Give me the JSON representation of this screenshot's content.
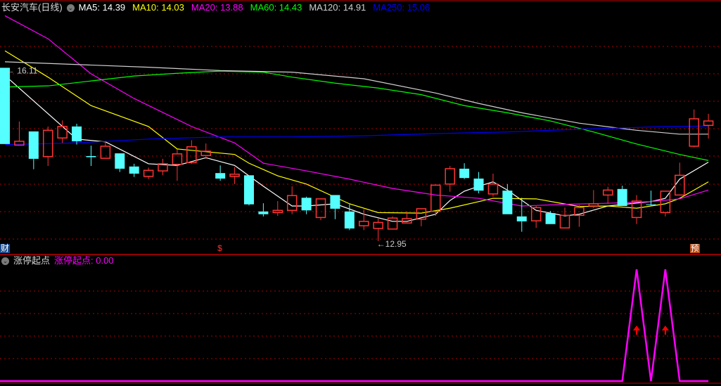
{
  "header": {
    "title": "长安汽车(日线)",
    "ma": [
      {
        "label": "MA5: 14.39",
        "color": "#ffffff"
      },
      {
        "label": "MA10: 14.03",
        "color": "#ffff00"
      },
      {
        "label": "MA20: 13.88",
        "color": "#ff00ff"
      },
      {
        "label": "MA60: 14.43",
        "color": "#00ff00"
      },
      {
        "label": "MA120: 14.91",
        "color": "#d0d0d0"
      },
      {
        "label": "MA250: 15.06",
        "color": "#0000ff"
      }
    ]
  },
  "indicator_header": {
    "name": "涨停起点",
    "value_label": "涨停起点: 0.00",
    "color": "#ff00ff"
  },
  "markers": {
    "cai": "财",
    "dollar": "$",
    "yu": "预"
  },
  "colors": {
    "up": "#ff3333",
    "down": "#55ffff",
    "grid": "#b00000",
    "border": "#c00000"
  },
  "chart_data": {
    "type": "candlestick",
    "price_labels": {
      "high": "16.11",
      "low": "12.95",
      "high_index": 0,
      "low_index": 26
    },
    "ylim": [
      12.55,
      17.15
    ],
    "candles": [
      {
        "o": 16.11,
        "h": 16.11,
        "l": 14.72,
        "c": 14.72
      },
      {
        "o": 14.7,
        "h": 15.13,
        "l": 14.7,
        "c": 14.77
      },
      {
        "o": 14.95,
        "h": 14.95,
        "l": 14.26,
        "c": 14.45
      },
      {
        "o": 14.49,
        "h": 15.04,
        "l": 14.32,
        "c": 14.97
      },
      {
        "o": 14.83,
        "h": 15.15,
        "l": 14.74,
        "c": 15.04
      },
      {
        "o": 15.04,
        "h": 15.09,
        "l": 14.71,
        "c": 14.77
      },
      {
        "o": 14.5,
        "h": 14.69,
        "l": 14.32,
        "c": 14.48
      },
      {
        "o": 14.46,
        "h": 14.76,
        "l": 14.46,
        "c": 14.68
      },
      {
        "o": 14.55,
        "h": 14.55,
        "l": 14.21,
        "c": 14.27
      },
      {
        "o": 14.31,
        "h": 14.36,
        "l": 14.12,
        "c": 14.18
      },
      {
        "o": 14.13,
        "h": 14.29,
        "l": 14.08,
        "c": 14.24
      },
      {
        "o": 14.23,
        "h": 14.45,
        "l": 14.15,
        "c": 14.36
      },
      {
        "o": 14.35,
        "h": 14.62,
        "l": 14.05,
        "c": 14.54
      },
      {
        "o": 14.38,
        "h": 14.79,
        "l": 14.36,
        "c": 14.67
      },
      {
        "o": 14.51,
        "h": 14.73,
        "l": 14.45,
        "c": 14.59
      },
      {
        "o": 14.19,
        "h": 14.33,
        "l": 14.05,
        "c": 14.09
      },
      {
        "o": 14.13,
        "h": 14.3,
        "l": 13.99,
        "c": 14.17
      },
      {
        "o": 14.15,
        "h": 14.15,
        "l": 13.6,
        "c": 13.62
      },
      {
        "o": 13.49,
        "h": 13.64,
        "l": 13.4,
        "c": 13.44
      },
      {
        "o": 13.47,
        "h": 13.68,
        "l": 13.41,
        "c": 13.51
      },
      {
        "o": 13.51,
        "h": 13.95,
        "l": 13.44,
        "c": 13.78
      },
      {
        "o": 13.74,
        "h": 13.76,
        "l": 13.44,
        "c": 13.51
      },
      {
        "o": 13.38,
        "h": 13.73,
        "l": 13.33,
        "c": 13.72
      },
      {
        "o": 13.79,
        "h": 13.79,
        "l": 13.35,
        "c": 13.54
      },
      {
        "o": 13.49,
        "h": 13.62,
        "l": 13.15,
        "c": 13.18
      },
      {
        "o": 13.23,
        "h": 13.53,
        "l": 13.15,
        "c": 13.31
      },
      {
        "o": 13.18,
        "h": 13.36,
        "l": 12.95,
        "c": 13.29
      },
      {
        "o": 13.17,
        "h": 13.4,
        "l": 13.17,
        "c": 13.37
      },
      {
        "o": 13.28,
        "h": 13.49,
        "l": 13.27,
        "c": 13.36
      },
      {
        "o": 13.35,
        "h": 13.54,
        "l": 13.22,
        "c": 13.54
      },
      {
        "o": 13.49,
        "h": 13.97,
        "l": 13.41,
        "c": 13.97
      },
      {
        "o": 13.99,
        "h": 14.32,
        "l": 13.85,
        "c": 14.27
      },
      {
        "o": 14.27,
        "h": 14.37,
        "l": 14.08,
        "c": 14.1
      },
      {
        "o": 14.09,
        "h": 14.21,
        "l": 13.82,
        "c": 13.87
      },
      {
        "o": 13.81,
        "h": 14.18,
        "l": 13.76,
        "c": 13.99
      },
      {
        "o": 13.87,
        "h": 13.99,
        "l": 13.44,
        "c": 13.44
      },
      {
        "o": 13.4,
        "h": 13.74,
        "l": 13.12,
        "c": 13.31
      },
      {
        "o": 13.32,
        "h": 13.59,
        "l": 13.19,
        "c": 13.56
      },
      {
        "o": 13.46,
        "h": 13.5,
        "l": 13.26,
        "c": 13.26
      },
      {
        "o": 13.19,
        "h": 13.56,
        "l": 13.19,
        "c": 13.42
      },
      {
        "o": 13.42,
        "h": 13.61,
        "l": 13.21,
        "c": 13.56
      },
      {
        "o": 13.59,
        "h": 13.88,
        "l": 13.55,
        "c": 13.63
      },
      {
        "o": 13.79,
        "h": 13.94,
        "l": 13.63,
        "c": 13.88
      },
      {
        "o": 13.9,
        "h": 13.96,
        "l": 13.59,
        "c": 13.59
      },
      {
        "o": 13.38,
        "h": 13.79,
        "l": 13.26,
        "c": 13.68
      },
      {
        "o": 13.62,
        "h": 13.87,
        "l": 13.6,
        "c": 13.61
      },
      {
        "o": 13.47,
        "h": 13.86,
        "l": 13.4,
        "c": 13.86
      },
      {
        "o": 13.79,
        "h": 14.38,
        "l": 13.79,
        "c": 14.15
      },
      {
        "o": 14.68,
        "h": 15.35,
        "l": 14.66,
        "c": 15.18
      },
      {
        "o": 15.06,
        "h": 15.27,
        "l": 14.82,
        "c": 15.14
      }
    ],
    "moving_averages": [
      {
        "name": "MA5",
        "color": "#ffffff",
        "points": [
          [
            0,
            15.97
          ],
          [
            5,
            14.81
          ],
          [
            7,
            14.76
          ],
          [
            10,
            14.36
          ],
          [
            12,
            14.33
          ],
          [
            14,
            14.47
          ],
          [
            16,
            14.33
          ],
          [
            17,
            14.14
          ],
          [
            18,
            13.95
          ],
          [
            20,
            13.59
          ],
          [
            21,
            13.59
          ],
          [
            23,
            13.63
          ],
          [
            25,
            13.44
          ],
          [
            27,
            13.31
          ],
          [
            28,
            13.31
          ],
          [
            30,
            13.44
          ],
          [
            31,
            13.69
          ],
          [
            32,
            13.86
          ],
          [
            33,
            13.95
          ],
          [
            34,
            14.03
          ],
          [
            35,
            13.88
          ],
          [
            37,
            13.51
          ],
          [
            39,
            13.41
          ],
          [
            40,
            13.44
          ],
          [
            42,
            13.59
          ],
          [
            45,
            13.67
          ],
          [
            46,
            13.73
          ],
          [
            47,
            14.08
          ],
          [
            49,
            14.39
          ]
        ]
      },
      {
        "name": "MA10",
        "color": "#ffff00",
        "points": [
          [
            0,
            16.42
          ],
          [
            3,
            15.94
          ],
          [
            6,
            15.42
          ],
          [
            10,
            15.04
          ],
          [
            12,
            14.63
          ],
          [
            16,
            14.53
          ],
          [
            17,
            14.37
          ],
          [
            19,
            14.14
          ],
          [
            21,
            13.99
          ],
          [
            24,
            13.63
          ],
          [
            26,
            13.47
          ],
          [
            29,
            13.46
          ],
          [
            31,
            13.55
          ],
          [
            34,
            13.73
          ],
          [
            37,
            13.72
          ],
          [
            40,
            13.58
          ],
          [
            42,
            13.59
          ],
          [
            44,
            13.55
          ],
          [
            46,
            13.63
          ],
          [
            47,
            13.73
          ],
          [
            48,
            13.88
          ],
          [
            49,
            14.03
          ]
        ]
      },
      {
        "name": "MA20",
        "color": "#ff00ff",
        "points": [
          [
            0,
            17.06
          ],
          [
            3,
            16.64
          ],
          [
            6,
            16.0
          ],
          [
            9,
            15.55
          ],
          [
            13,
            15.04
          ],
          [
            16,
            14.74
          ],
          [
            18,
            14.37
          ],
          [
            21,
            14.23
          ],
          [
            24,
            14.08
          ],
          [
            27,
            13.91
          ],
          [
            30,
            13.79
          ],
          [
            33,
            13.73
          ],
          [
            36,
            13.59
          ],
          [
            39,
            13.62
          ],
          [
            42,
            13.64
          ],
          [
            45,
            13.67
          ],
          [
            47,
            13.72
          ],
          [
            49,
            13.88
          ]
        ]
      },
      {
        "name": "MA60",
        "color": "#00ff00",
        "points": [
          [
            0,
            15.76
          ],
          [
            3,
            15.78
          ],
          [
            6,
            15.87
          ],
          [
            9,
            15.96
          ],
          [
            12,
            16.01
          ],
          [
            15,
            16.05
          ],
          [
            18,
            16.03
          ],
          [
            20,
            15.94
          ],
          [
            23,
            15.83
          ],
          [
            26,
            15.74
          ],
          [
            29,
            15.62
          ],
          [
            32,
            15.42
          ],
          [
            35,
            15.29
          ],
          [
            38,
            15.14
          ],
          [
            41,
            14.94
          ],
          [
            44,
            14.72
          ],
          [
            47,
            14.53
          ],
          [
            49,
            14.42
          ]
        ]
      },
      {
        "name": "MA120",
        "color": "#d0d0d0",
        "points": [
          [
            0,
            16.22
          ],
          [
            5,
            16.17
          ],
          [
            10,
            16.12
          ],
          [
            15,
            16.06
          ],
          [
            20,
            16.03
          ],
          [
            25,
            15.91
          ],
          [
            30,
            15.65
          ],
          [
            33,
            15.46
          ],
          [
            36,
            15.29
          ],
          [
            40,
            15.1
          ],
          [
            44,
            14.97
          ],
          [
            47,
            14.9
          ],
          [
            49,
            14.9
          ]
        ]
      },
      {
        "name": "MA250",
        "color": "#0000ff",
        "points": [
          [
            0,
            14.71
          ],
          [
            5,
            14.74
          ],
          [
            10,
            14.81
          ],
          [
            15,
            14.85
          ],
          [
            20,
            14.85
          ],
          [
            25,
            14.87
          ],
          [
            30,
            14.91
          ],
          [
            35,
            14.94
          ],
          [
            40,
            14.99
          ],
          [
            45,
            15.03
          ],
          [
            47,
            15.04
          ],
          [
            49,
            15.05
          ]
        ]
      }
    ],
    "marker_indices": {
      "cai": 0,
      "dollar": 15,
      "yu": 48
    },
    "indicator": {
      "name": "涨停起点",
      "values": [
        0,
        0,
        0,
        0,
        0,
        0,
        0,
        0,
        0,
        0,
        0,
        0,
        0,
        0,
        0,
        0,
        0,
        0,
        0,
        0,
        0,
        0,
        0,
        0,
        0,
        0,
        0,
        0,
        0,
        0,
        0,
        0,
        0,
        0,
        0,
        0,
        0,
        0,
        0,
        0,
        0,
        0,
        0,
        0,
        1,
        0,
        1,
        0,
        0,
        0
      ],
      "signal_indices": [
        44,
        46
      ],
      "ylim": [
        0,
        1
      ]
    }
  }
}
